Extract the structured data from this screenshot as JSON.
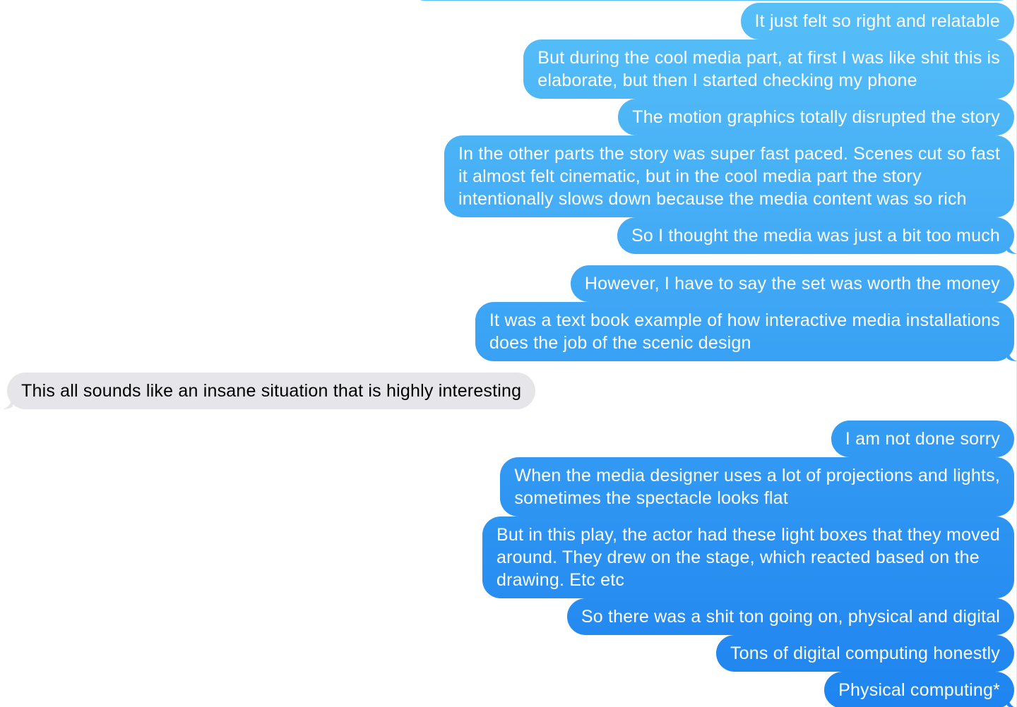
{
  "colors": {
    "sent_gradient_top": "#56bff8",
    "sent_gradient_bottom": "#1e84f0",
    "received_bubble": "#e5e5ea",
    "received_text": "#000000",
    "sent_text": "#ffffff"
  },
  "messages": [
    {
      "dir": "sent",
      "text": "It just felt so right and relatable"
    },
    {
      "dir": "sent",
      "text": "But during the cool media part, at first I was like shit this is\nelaborate, but then I started checking my phone"
    },
    {
      "dir": "sent",
      "text": "The motion graphics totally disrupted the story"
    },
    {
      "dir": "sent",
      "text": "In the other parts the story was super fast paced. Scenes cut so fast\nit almost felt cinematic, but in the cool media part the story\nintentionally slows down because the media content was so rich"
    },
    {
      "dir": "sent",
      "text": "So I thought the media was just a bit too much"
    },
    {
      "dir": "sent",
      "text": "However, I have to say the set was worth the money"
    },
    {
      "dir": "sent",
      "text": "It was a text book example of how interactive media installations\ndoes the job of the scenic design"
    },
    {
      "dir": "received",
      "text": "This all sounds like an insane situation that is highly interesting"
    },
    {
      "dir": "sent",
      "text": "I am not done sorry"
    },
    {
      "dir": "sent",
      "text": "When the media designer uses a lot of projections and lights,\nsometimes the spectacle looks flat"
    },
    {
      "dir": "sent",
      "text": "But in this play, the actor had these light boxes that they moved\naround. They drew on the stage, which reacted based on the\ndrawing. Etc etc"
    },
    {
      "dir": "sent",
      "text": "So there was a shit ton going on, physical and digital"
    },
    {
      "dir": "sent",
      "text": "Tons of digital computing honestly"
    },
    {
      "dir": "sent",
      "text": "Physical computing*"
    }
  ]
}
